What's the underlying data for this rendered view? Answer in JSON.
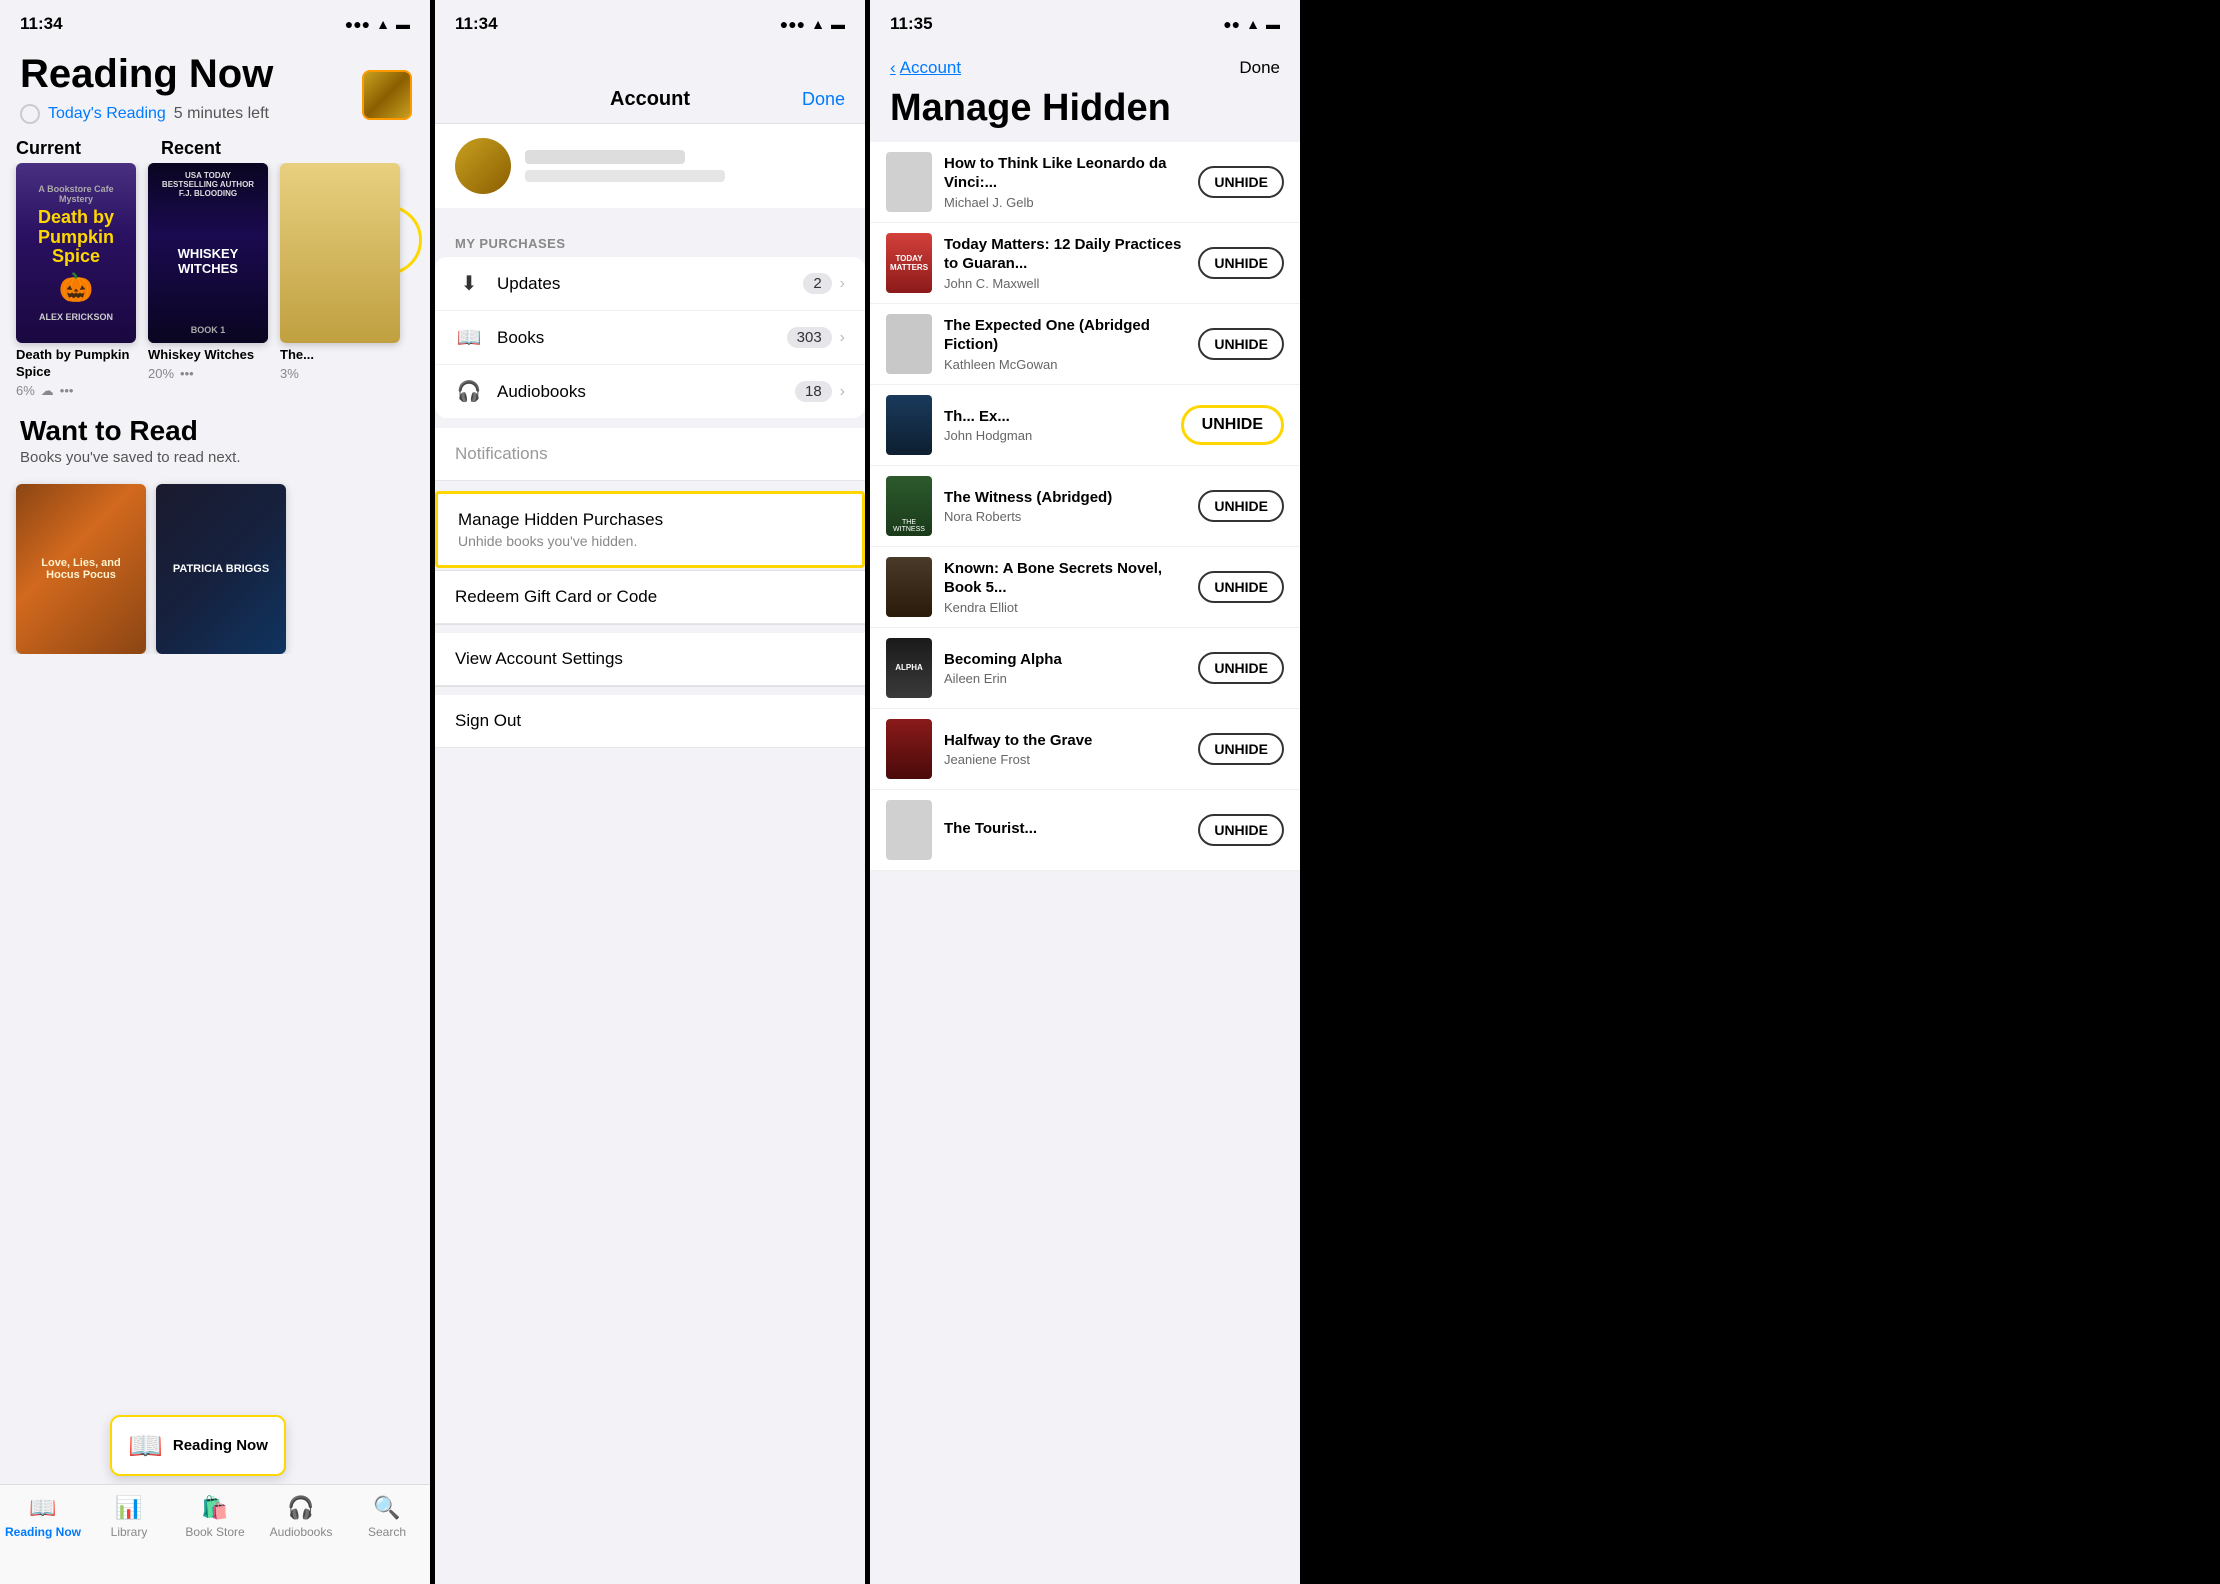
{
  "panel1": {
    "statusBar": {
      "time": "11:34",
      "locationIcon": "◀",
      "signal": "●●●",
      "wifi": "wifi",
      "battery": "battery"
    },
    "title": "Reading Now",
    "readingGoal": {
      "linkText": "Today's Reading",
      "timeLeft": "5 minutes left"
    },
    "currentLabel": "Current",
    "recentLabel": "Recent",
    "books": [
      {
        "title": "Death by Pumpkin Spice",
        "author": "Alex Erickson",
        "progress": "6%",
        "series": "A Bookstore Cafe Mystery"
      },
      {
        "title": "Whiskey Witches",
        "author": "F.J. Blooding",
        "series": "Book 1",
        "progress": "20%"
      },
      {
        "title": "The...",
        "progress": "3%"
      }
    ],
    "wantToRead": {
      "title": "Want to Read",
      "subtitle": "Books you've saved to read next."
    },
    "bottomNav": [
      {
        "label": "Reading Now",
        "icon": "📖",
        "active": true
      },
      {
        "label": "Library",
        "icon": "📊",
        "active": false
      },
      {
        "label": "Book Store",
        "icon": "🛍️",
        "active": false
      },
      {
        "label": "Audiobooks",
        "icon": "🎧",
        "active": false
      },
      {
        "label": "Search",
        "icon": "🔍",
        "active": false
      }
    ]
  },
  "panel2": {
    "statusBar": {
      "time": "11:34"
    },
    "title": "Account",
    "doneLabel": "Done",
    "purchasesSection": "MY PURCHASES",
    "menuItems": [
      {
        "icon": "⬇️",
        "label": "Updates",
        "badge": "2"
      },
      {
        "icon": "📖",
        "label": "Books",
        "badge": "303"
      },
      {
        "icon": "🎧",
        "label": "Audiobooks",
        "badge": "18"
      }
    ],
    "standaloneItems": [
      {
        "label": "Manage Hidden Purchases",
        "sublabel": "Unhide books you've hidden."
      },
      {
        "label": "Redeem Gift Card or Code"
      },
      {
        "label": "View Account Settings"
      },
      {
        "label": "Sign Out"
      }
    ]
  },
  "panel3": {
    "statusBar": {
      "time": "11:35"
    },
    "backLabel": "Account",
    "doneLabel": "Done",
    "title": "Manage Hidden",
    "books": [
      {
        "title": "How to Think Like Leonardo da Vinci:...",
        "author": "Michael J. Gelb",
        "coverClass": "hb-cover-gray",
        "unhideLabel": "UNHIDE"
      },
      {
        "title": "Today Matters: 12 Daily Practices to Guaran...",
        "author": "John C. Maxwell",
        "coverClass": "hb-cover-today",
        "unhideLabel": "UNHIDE"
      },
      {
        "title": "The Expected One (Abridged Fiction)",
        "author": "Kathleen McGowan",
        "coverClass": "hb-cover-expected",
        "unhideLabel": "UNHIDE"
      },
      {
        "title": "Th... Ex...",
        "author": "John Hodgman",
        "coverClass": "hb-cover-beast",
        "unhideLabel": "UNHIDE",
        "highlighted": true
      },
      {
        "title": "The Witness (Abridged)",
        "author": "Nora Roberts",
        "coverClass": "hb-cover-witness",
        "unhideLabel": "UNHIDE"
      },
      {
        "title": "Known: A Bone Secrets Novel, Book 5...",
        "author": "Kendra Elliot",
        "coverClass": "hb-cover-known",
        "unhideLabel": "UNHIDE"
      },
      {
        "title": "Becoming Alpha",
        "author": "Aileen Erin",
        "coverClass": "hb-cover-alpha",
        "unhideLabel": "UNHIDE"
      },
      {
        "title": "Halfway to the Grave",
        "author": "Jeaniene Frost",
        "coverClass": "hb-cover-halfway",
        "unhideLabel": "UNHIDE"
      },
      {
        "title": "The Tourist...",
        "author": "",
        "coverClass": "hb-cover-gray",
        "unhideLabel": "UNHIDE"
      }
    ]
  }
}
